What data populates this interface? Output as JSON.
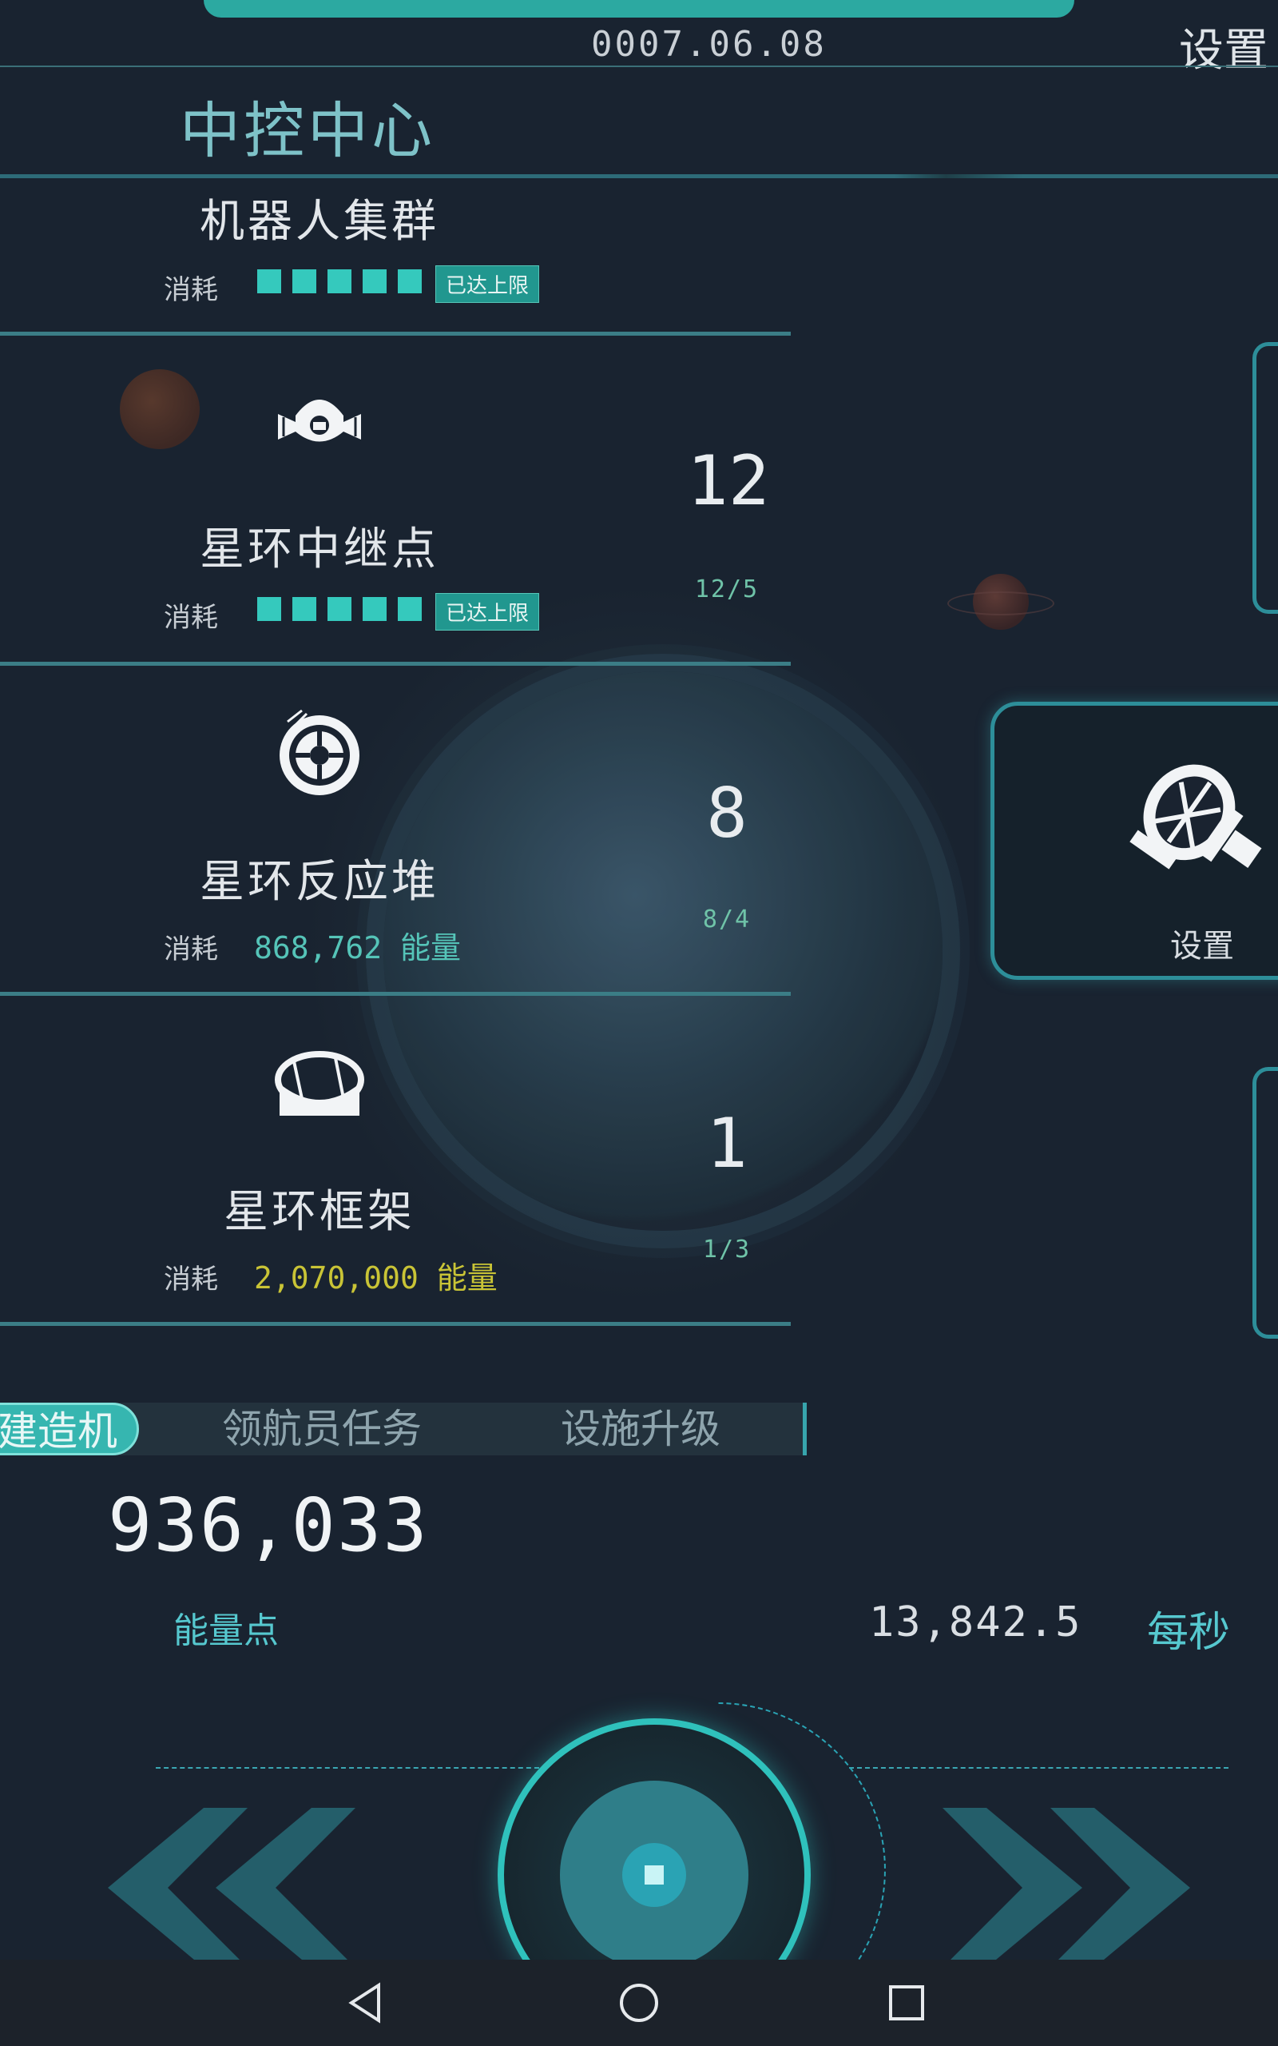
{
  "header": {
    "date": "0007.06.08",
    "settings_label": "设置",
    "title": "中控中心"
  },
  "buildings": [
    {
      "name": "机器人集群",
      "count": "",
      "ratio": "",
      "cost_label": "消耗",
      "cost_value": "",
      "cost_unit": "",
      "badge": "已达上限",
      "icon": "robot-cluster-icon",
      "cost_color": "#3fd6c7"
    },
    {
      "name": "星环中继点",
      "count": "12",
      "ratio": "12/5",
      "cost_label": "消耗",
      "cost_value": "",
      "cost_unit": "",
      "badge": "已达上限",
      "icon": "relay-station-icon",
      "cost_color": "#3fd6c7"
    },
    {
      "name": "星环反应堆",
      "count": "8",
      "ratio": "8/4",
      "cost_label": "消耗",
      "cost_value": "868,762",
      "cost_unit": "能量",
      "badge": "",
      "icon": "reactor-icon",
      "cost_color": "#55c4b8"
    },
    {
      "name": "星环框架",
      "count": "1",
      "ratio": "1/3",
      "cost_label": "消耗",
      "cost_value": "2,070,000",
      "cost_unit": "能量",
      "badge": "",
      "icon": "ring-frame-icon",
      "cost_color": "#c9c436"
    }
  ],
  "tabs": [
    "建造机",
    "领航员任务",
    "设施升级"
  ],
  "energy": {
    "value": "936,033",
    "label": "能量点",
    "rate": "13,842.5",
    "rate_unit": "每秒"
  },
  "side_panel": {
    "label": "设置",
    "icon": "satellite-icon"
  },
  "nav": {
    "prev_icon": "double-chevron-left-icon",
    "next_icon": "double-chevron-right-icon",
    "main_button_icon": "stop-square-icon"
  },
  "system_nav": [
    "back-icon",
    "home-icon",
    "recents-icon"
  ],
  "colors": {
    "accent": "#2fc1bc",
    "background": "#1a2330",
    "warning_cost": "#c9c436"
  }
}
